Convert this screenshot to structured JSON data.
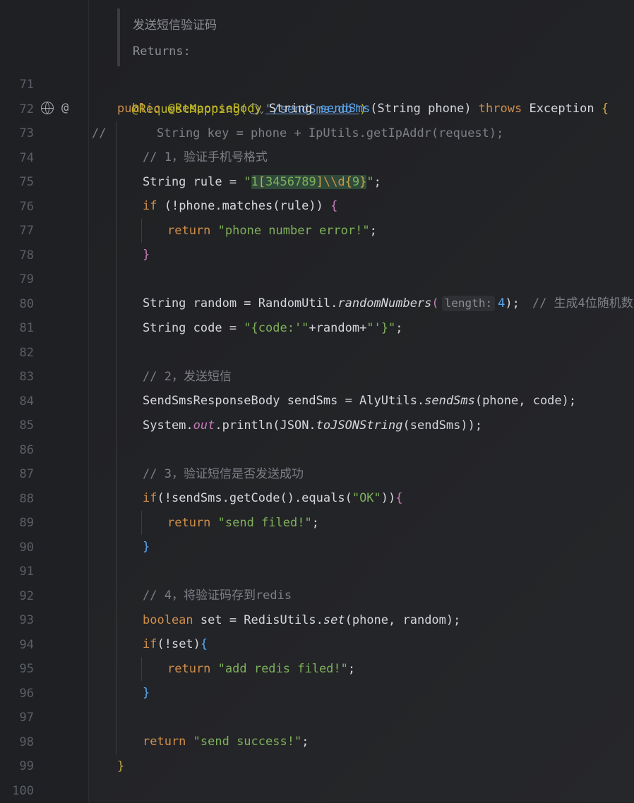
{
  "doc": {
    "summary": "发送短信验证码",
    "returns": "Returns:"
  },
  "lines": [
    {
      "no": "71"
    },
    {
      "no": "72"
    },
    {
      "no": "73"
    },
    {
      "no": "74"
    },
    {
      "no": "75"
    },
    {
      "no": "76"
    },
    {
      "no": "77"
    },
    {
      "no": "78"
    },
    {
      "no": "79"
    },
    {
      "no": "80"
    },
    {
      "no": "81"
    },
    {
      "no": "82"
    },
    {
      "no": "83"
    },
    {
      "no": "84"
    },
    {
      "no": "85"
    },
    {
      "no": "86"
    },
    {
      "no": "87"
    },
    {
      "no": "88"
    },
    {
      "no": "89"
    },
    {
      "no": "90"
    },
    {
      "no": "91"
    },
    {
      "no": "92"
    },
    {
      "no": "93"
    },
    {
      "no": "94"
    },
    {
      "no": "95"
    },
    {
      "no": "96"
    },
    {
      "no": "97"
    },
    {
      "no": "98"
    },
    {
      "no": "99"
    },
    {
      "no": "100"
    }
  ],
  "code": {
    "l71": {
      "anno": "@RequestMapping(",
      "path": "\"/sendSms.do\"",
      "close": ")"
    },
    "l72": {
      "public": "public ",
      "anno": "@ResponseBody ",
      "type": "String ",
      "method": "sendSms",
      "params": "(String phone) ",
      "throws": "throws ",
      "exc": "Exception ",
      "brace": "{"
    },
    "l73": {
      "slashes": "//",
      "text": "String key = phone + IpUtils.getIpAddr(request);"
    },
    "l74": {
      "text": "// 1，验证手机号格式"
    },
    "l75": {
      "pre": "String rule = ",
      "q1": "\"",
      "d1": "1",
      "c1": "[",
      "digits": "3456789",
      "c2": "]",
      "esc": "\\\\d",
      "b1": "{",
      "nine": "9",
      "b2": "}",
      "q2": "\"",
      "end": ";"
    },
    "l76": {
      "if": "if ",
      "cond": "(!phone.matches(rule)) ",
      "brace": "{"
    },
    "l77": {
      "ret": "return ",
      "str": "\"phone number error!\"",
      "end": ";"
    },
    "l78": {
      "brace": "}"
    },
    "l80": {
      "pre": "String random = RandomUtil.",
      "call": "randomNumbers",
      "open": "(",
      "hint": "length:",
      "arg": "4",
      "close": ");",
      "cmt": "// 生成4位随机数"
    },
    "l81": {
      "pre": "String code = ",
      "s1": "\"{code:'\"",
      "mid": "+random+",
      "s2": "\"'}\"",
      "end": ";"
    },
    "l83": {
      "text": "// 2，发送短信"
    },
    "l84": {
      "pre": "SendSmsResponseBody sendSms = AlyUtils.",
      "call": "sendSms",
      "args": "(phone, code);"
    },
    "l85": {
      "pre": "System.",
      "field": "out",
      "mid": ".println(JSON.",
      "call": "toJSONString",
      "args": "(sendSms));"
    },
    "l87": {
      "text": "// 3，验证短信是否发送成功"
    },
    "l88": {
      "if": "if",
      "cond": "(!sendSms.getCode().equals(",
      "str": "\"OK\"",
      "close": "))",
      "brace": "{"
    },
    "l89": {
      "ret": "return ",
      "str": "\"send filed!\"",
      "end": ";"
    },
    "l90": {
      "brace": "}"
    },
    "l92": {
      "text": "// 4，将验证码存到redis"
    },
    "l93": {
      "kw": "boolean ",
      "pre": "set = RedisUtils.",
      "call": "set",
      "args": "(phone, random);"
    },
    "l94": {
      "if": "if",
      "cond": "(!set)",
      "brace": "{"
    },
    "l95": {
      "ret": "return ",
      "str": "\"add redis filed!\"",
      "end": ";"
    },
    "l96": {
      "brace": "}"
    },
    "l98": {
      "ret": "return ",
      "str": "\"send success!\"",
      "end": ";"
    },
    "l99": {
      "brace": "}"
    }
  },
  "icons": {
    "web_endpoint": "globe-icon",
    "at": "@",
    "chevron": "chevron-down-icon"
  },
  "colors": {
    "background": "#1f2023",
    "keyword": "#cf8e4b",
    "annotation": "#bbb529",
    "string": "#7fb05b",
    "comment": "#7c7f86",
    "method": "#56a8f5"
  }
}
